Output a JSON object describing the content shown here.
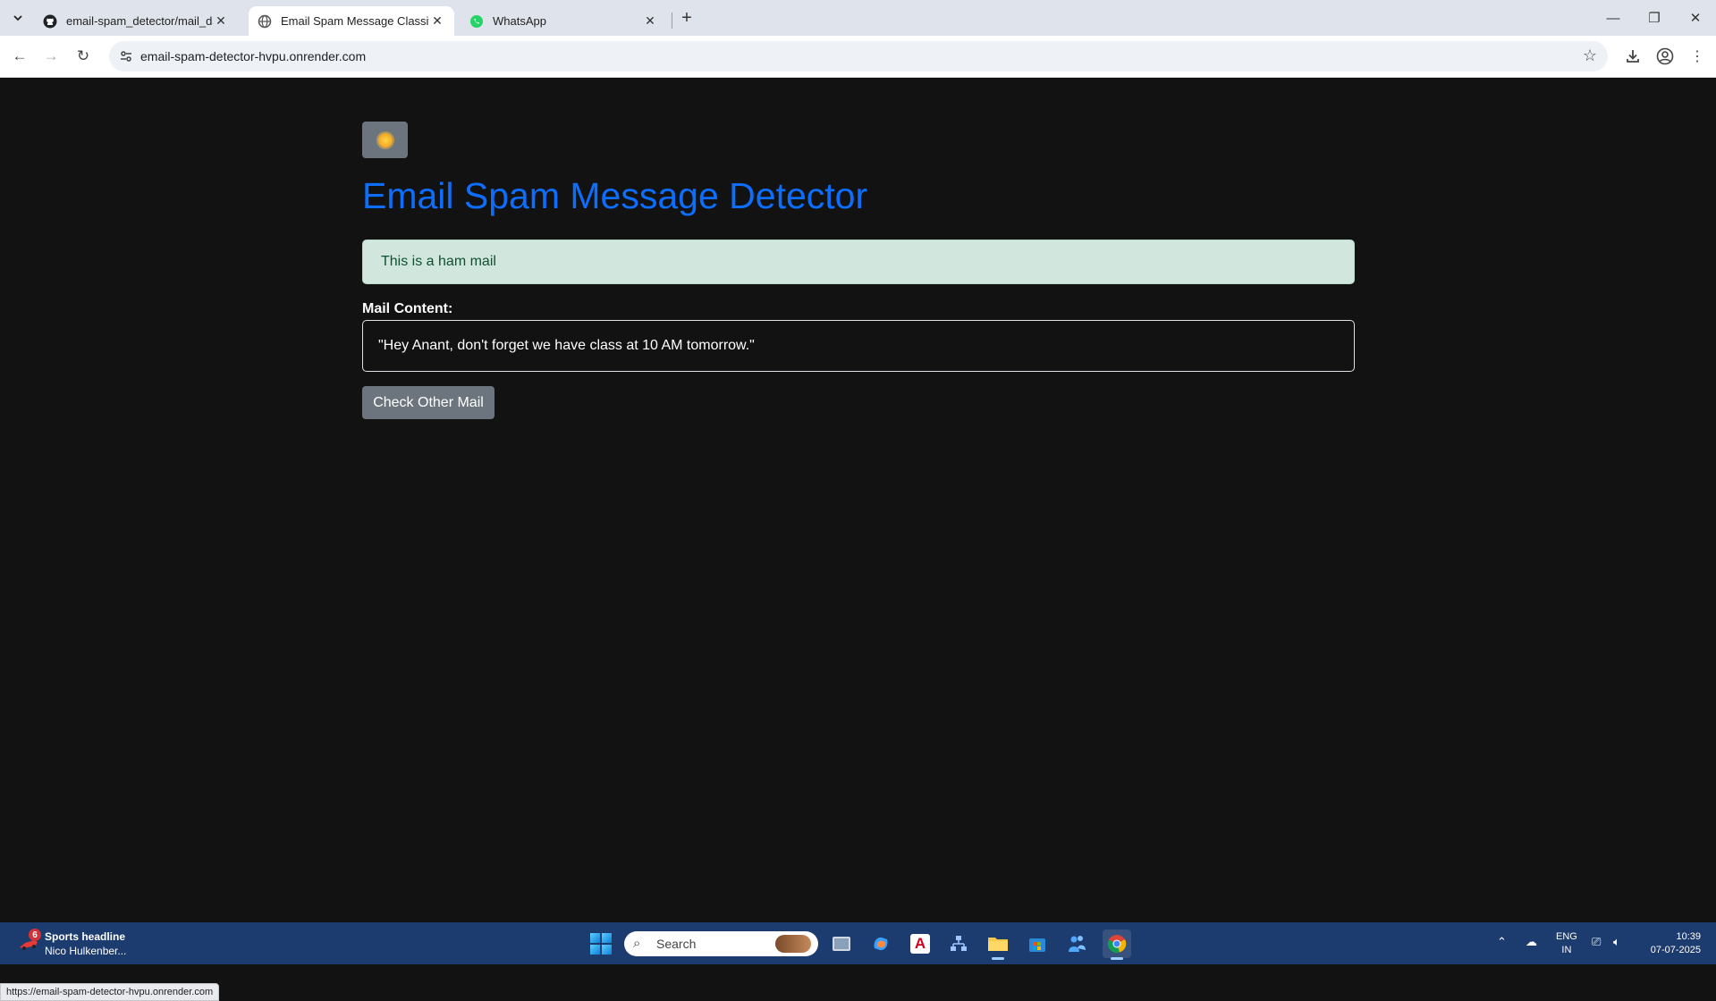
{
  "browser": {
    "tabs": [
      {
        "title": "email-spam_detector/mail_data",
        "icon": "github-icon",
        "active": false
      },
      {
        "title": "Email Spam Message Classificat",
        "icon": "globe-icon",
        "active": true
      },
      {
        "title": "WhatsApp",
        "icon": "whatsapp-icon",
        "active": false
      }
    ],
    "address": "email-spam-detector-hvpu.onrender.com",
    "status_url": "https://email-spam-detector-hvpu.onrender.com"
  },
  "page": {
    "theme_toggle_icon": "sun-icon",
    "title": "Email Spam Message Detector",
    "result_alert": "This is a ham mail",
    "field_label": "Mail Content:",
    "mail_content": "\"Hey Anant, don't forget we have class at 10 AM tomorrow.\"",
    "check_button": "Check Other Mail",
    "colors": {
      "title": "#0d6efd",
      "alert_bg": "#d1e7dd",
      "alert_text": "#0f5132",
      "button": "#6c757d",
      "background": "#121212"
    }
  },
  "taskbar": {
    "news_badge": "6",
    "news_title": "Sports headline",
    "news_subtitle": "Nico Hulkenber...",
    "search_label": "Search",
    "lang_line1": "ENG",
    "lang_line2": "IN",
    "time": "10:39",
    "date": "07-07-2025"
  }
}
